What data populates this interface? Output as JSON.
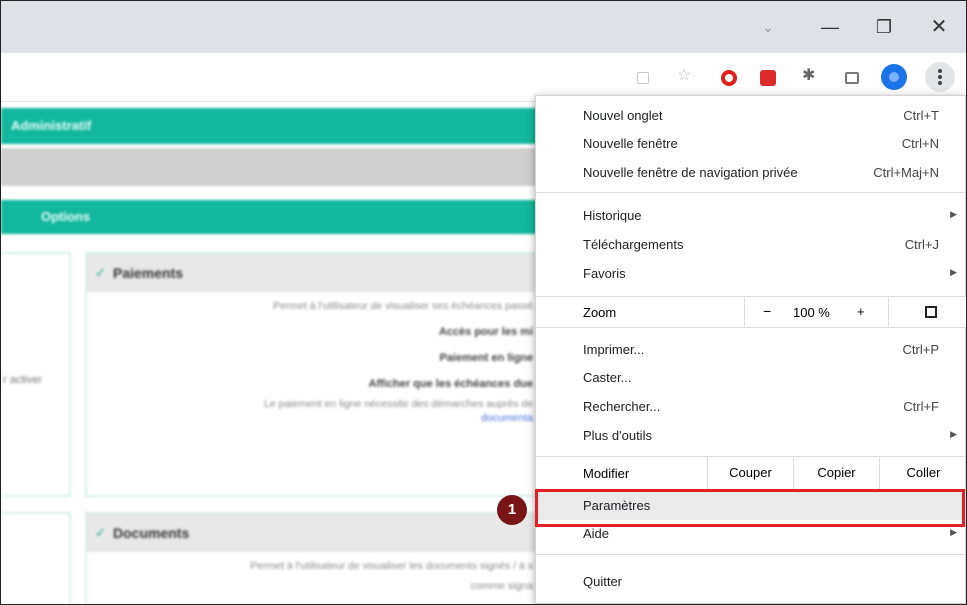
{
  "window": {
    "controls": {
      "tab_search": "⌄",
      "minimize": "—",
      "maximize": "❐",
      "close": "✕"
    }
  },
  "toolbar": {
    "icons": [
      "share-icon",
      "bookmark-star-icon",
      "opera-extension-icon",
      "pdf-extension-icon",
      "extensions-puzzle-icon",
      "side-panel-icon",
      "profile-avatar",
      "chrome-menu-icon"
    ],
    "star_glyph": "☆",
    "puzzle_glyph": "✱"
  },
  "background_page": {
    "section_admin": "Administratif",
    "section_options": "Options",
    "left_label": "r activer",
    "card1": {
      "title": "Paiements",
      "lines": [
        "Permet à l'utilisateur de visualiser ses échéances passé",
        "Accès pour les mi",
        "Paiement en ligne",
        "Afficher que les échéances due",
        "Le paiement en ligne nécessite des démarches auprès de",
        "documenta"
      ]
    },
    "card2": {
      "title": "Documents",
      "lines": [
        "Permet à l'utilisateur de visualiser les documents signés / à s",
        "comme signa"
      ]
    }
  },
  "menu": {
    "new_tab": {
      "label": "Nouvel onglet",
      "shortcut": "Ctrl+T"
    },
    "new_window": {
      "label": "Nouvelle fenêtre",
      "shortcut": "Ctrl+N"
    },
    "incognito": {
      "label": "Nouvelle fenêtre de navigation privée",
      "shortcut": "Ctrl+Maj+N"
    },
    "history": {
      "label": "Historique"
    },
    "downloads": {
      "label": "Téléchargements",
      "shortcut": "Ctrl+J"
    },
    "bookmarks": {
      "label": "Favoris"
    },
    "zoom": {
      "label": "Zoom",
      "minus": "−",
      "value": "100 %",
      "plus": "+"
    },
    "print": {
      "label": "Imprimer...",
      "shortcut": "Ctrl+P"
    },
    "cast": {
      "label": "Caster..."
    },
    "find": {
      "label": "Rechercher...",
      "shortcut": "Ctrl+F"
    },
    "more_tools": {
      "label": "Plus d'outils"
    },
    "edit": {
      "label": "Modifier",
      "cut": "Couper",
      "copy": "Copier",
      "paste": "Coller"
    },
    "settings": {
      "label": "Paramètres"
    },
    "help": {
      "label": "Aide"
    },
    "exit": {
      "label": "Quitter"
    },
    "submenu_arrow": "▶"
  },
  "annotation": {
    "step_number": "1",
    "highlight_color": "#e41f25",
    "badge_color": "#7a1517"
  },
  "colors": {
    "accent_teal": "#12b79c"
  }
}
